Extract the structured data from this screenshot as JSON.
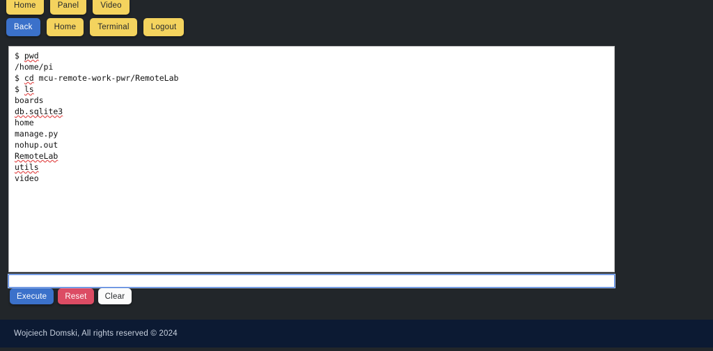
{
  "page": {
    "background_color": "#22262a",
    "title": "Terminal"
  },
  "nav": {
    "top_row": [
      {
        "label": "Home",
        "variant": "warning"
      },
      {
        "label": "Panel",
        "variant": "warning"
      },
      {
        "label": "Video",
        "variant": "warning"
      }
    ],
    "second_row": [
      {
        "label": "Back",
        "variant": "primary"
      },
      {
        "label": "Home",
        "variant": "warning"
      },
      {
        "label": "Terminal",
        "variant": "warning"
      },
      {
        "label": "Logout",
        "variant": "warning"
      }
    ],
    "colors": {
      "warning": "#f4d35e",
      "primary": "#3b71ca"
    }
  },
  "terminal": {
    "lines": [
      {
        "text": "$ pwd",
        "misspelled": [
          "pwd"
        ]
      },
      {
        "text": "/home/pi",
        "misspelled": []
      },
      {
        "text": "$ cd mcu-remote-work-pwr/RemoteLab",
        "misspelled": [
          "cd",
          "mcu-remote-work-pwr",
          "RemoteLab"
        ]
      },
      {
        "text": "$ ls",
        "misspelled": [
          "ls"
        ]
      },
      {
        "text": "boards",
        "misspelled": []
      },
      {
        "text": "db.sqlite3",
        "misspelled": [
          "db.sqlite3"
        ]
      },
      {
        "text": "home",
        "misspelled": []
      },
      {
        "text": "manage.py",
        "misspelled": [
          "py"
        ]
      },
      {
        "text": "nohup.out",
        "misspelled": [
          "nohup"
        ]
      },
      {
        "text": "RemoteLab",
        "misspelled": [
          "RemoteLab"
        ]
      },
      {
        "text": "utils",
        "misspelled": [
          "utils"
        ]
      },
      {
        "text": "video",
        "misspelled": []
      }
    ],
    "background_color": "#ffffff",
    "text_color": "#111111",
    "spellcheck_color": "#e24b4b"
  },
  "command_input": {
    "value": "",
    "placeholder": "",
    "focused": true,
    "border_color": "#4a7ddc"
  },
  "actions": [
    {
      "label": "Execute",
      "variant": "primary",
      "color": "#3b71ca"
    },
    {
      "label": "Reset",
      "variant": "danger",
      "color": "#dc4c64"
    },
    {
      "label": "Clear",
      "variant": "light",
      "color": "#fbfbfb"
    }
  ],
  "footer": {
    "text": "Wojciech Domski, All rights reserved © 2024",
    "background_color": "#0c1a33",
    "text_color": "#c9d2e0"
  }
}
